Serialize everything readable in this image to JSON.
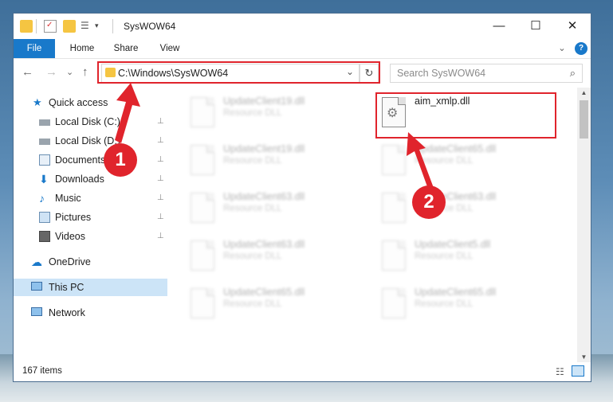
{
  "window": {
    "title": "SysWOW64",
    "controls": {
      "minimize": "—",
      "maximize": "☐",
      "close": "✕"
    }
  },
  "ribbon": {
    "tabs": [
      "File",
      "Home",
      "Share",
      "View"
    ],
    "expand": "⌄",
    "help": "?"
  },
  "address": {
    "path": "C:\\Windows\\SysWOW64",
    "dropdown": "⌄",
    "refresh": "↻"
  },
  "search": {
    "placeholder": "Search SysWOW64",
    "icon": "⌕"
  },
  "nav": {
    "back": "←",
    "forward": "→",
    "recent": "⌄",
    "up": "↑",
    "items": [
      {
        "label": "Quick access",
        "icon": "star-icon",
        "pinned": false
      },
      {
        "label": "Local Disk (C:)",
        "icon": "drive-icon",
        "pinned": true
      },
      {
        "label": "Local Disk (D:)",
        "icon": "drive-icon",
        "pinned": true
      },
      {
        "label": "Documents",
        "icon": "documents-icon",
        "pinned": true
      },
      {
        "label": "Downloads",
        "icon": "download-icon",
        "pinned": true
      },
      {
        "label": "Music",
        "icon": "music-icon",
        "pinned": true
      },
      {
        "label": "Pictures",
        "icon": "pictures-icon",
        "pinned": true
      },
      {
        "label": "Videos",
        "icon": "videos-icon",
        "pinned": true
      },
      {
        "label": "OneDrive",
        "icon": "cloud-icon",
        "pinned": false
      },
      {
        "label": "This PC",
        "icon": "pc-icon",
        "pinned": false
      },
      {
        "label": "Network",
        "icon": "network-icon",
        "pinned": false
      }
    ],
    "pin_glyph": "📌"
  },
  "files": [
    {
      "name": "UpdateClient19.dll",
      "type": "Resource DLL"
    },
    {
      "name": "aim_xmlp.dll",
      "type": ""
    },
    {
      "name": "UpdateClient19.dll",
      "type": "Resource DLL"
    },
    {
      "name": "UpdateClient65.dll",
      "type": "Resource DLL"
    },
    {
      "name": "UpdateClient63.dll",
      "type": "Resource DLL"
    },
    {
      "name": "UpdateClient63.dll",
      "type": "Resource DLL"
    },
    {
      "name": "UpdateClient63.dll",
      "type": "Resource DLL"
    },
    {
      "name": "UpdateClient5.dll",
      "type": "Resource DLL"
    },
    {
      "name": "UpdateClient65.dll",
      "type": "Resource DLL"
    },
    {
      "name": "UpdateClient65.dll",
      "type": "Resource DLL"
    }
  ],
  "status": {
    "items_count": "167 items"
  },
  "annotations": {
    "step1": "1",
    "step2": "2",
    "color": "#e0242c"
  },
  "colors": {
    "accent": "#1979ca",
    "selection": "#cce4f7",
    "highlight": "#e0242c"
  }
}
